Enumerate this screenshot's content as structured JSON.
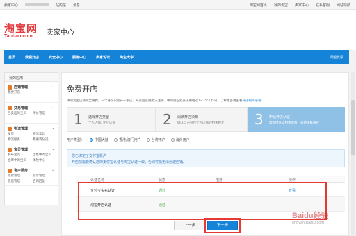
{
  "topbar": {
    "left": [
      "卖家中心",
      "站内信",
      "消息"
    ],
    "right": [
      "淘宝网首页",
      "我的淘宝",
      "卖家中心",
      "联系客服",
      "网站导航"
    ]
  },
  "header": {
    "logo_main": "淘宝网",
    "logo_sub": "Taobao.com",
    "title": "卖家中心"
  },
  "nav": {
    "items": [
      "首页",
      "我要开店",
      "安全中心",
      "服务中心",
      "卖家论坛",
      "淘宝大学"
    ],
    "right_link": "问题反馈"
  },
  "sidebar": {
    "title": "我的应用",
    "groups": [
      {
        "title": "店铺管理",
        "subs": [
          "我要开店",
          ""
        ]
      },
      {
        "title": "交易管理",
        "subs": [
          "已卖出的宝贝",
          "评价管理"
        ]
      },
      {
        "title": "物流管理",
        "subs": [
          "发货",
          "物流工具",
          "物流服务",
          "我要寄快递"
        ]
      },
      {
        "title": "宝贝管理",
        "subs": [
          "发布宝贝",
          "出售中的宝贝",
          "仓库中的宝贝",
          "体检中心"
        ]
      },
      {
        "title": "客户服务",
        "subs": [
          "退款管理",
          "投诉管理",
          "售后管理",
          "咨询回复"
        ]
      }
    ]
  },
  "main": {
    "title": "免费开店",
    "desc_text": "申请淘宝店铺完全免费，一个身份只能开一家店，开店后店铺无法注销，申请到正式开店要经过1~3个工作日。了解更多请查看",
    "desc_link": "开店规则必看",
    "steps": [
      {
        "num": "1",
        "title": "选择开店类型",
        "desc": "个人店铺, 企业店铺"
      },
      {
        "num": "2",
        "title": "阅读开店须知",
        "desc": "确认自己符合个人店铺的相关规定"
      },
      {
        "num": "3",
        "title": "申请开店认证",
        "desc": "需提供认证相关资料，等待审核通过"
      }
    ],
    "radios": {
      "label": "用户类型：",
      "options": [
        {
          "label": "中国大陆",
          "checked": true
        },
        {
          "label": "香港/澳门用户",
          "checked": false
        },
        {
          "label": "台湾用户",
          "checked": false
        },
        {
          "label": "海外用户",
          "checked": false
        }
      ]
    },
    "info_line1": "您已绑定了支付宝账户",
    "info_line2": "开店前需要确认您的支付宝认证与淘宝认证一致，否则可能无法创建店铺。",
    "table": {
      "headers": [
        "认证名称",
        "状态",
        "描述",
        "操作"
      ],
      "rows": [
        {
          "name": "支付宝实名认证",
          "status": "通过",
          "op": "查看"
        },
        {
          "name": "淘宝开店认证",
          "status": "通过",
          "op": ""
        }
      ]
    },
    "btn_prev": "上一步",
    "btn_next": "下一步"
  },
  "watermark": {
    "text": "Baidu经验",
    "sub": "jingyan.baidu.com"
  },
  "colors": {
    "brand_blue": "#1583d8",
    "taobao_red": "#e4393c",
    "highlight_red": "#e53935",
    "status_green": "#4caf50",
    "step_active": "#8fc0e6"
  }
}
